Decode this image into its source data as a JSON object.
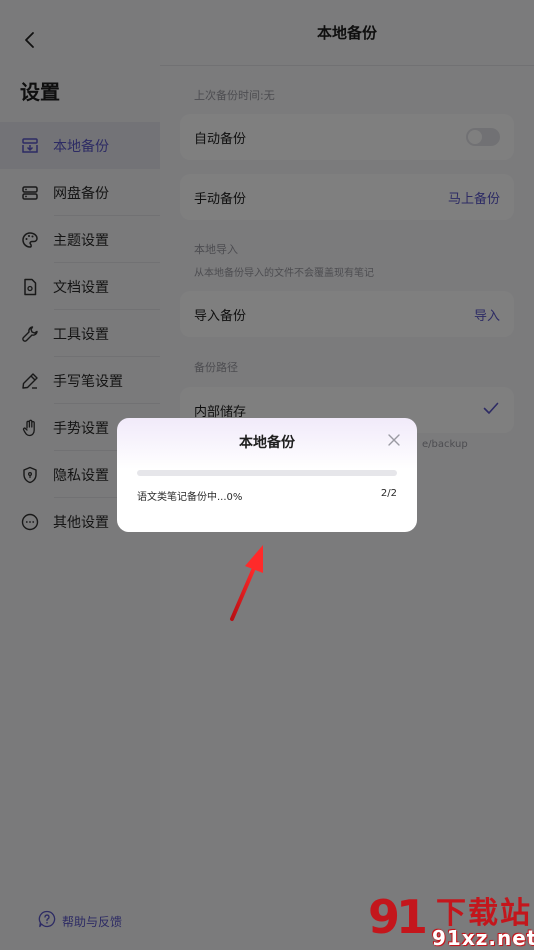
{
  "sidebar": {
    "title": "设置",
    "items": [
      {
        "label": "本地备份",
        "icon": "local-backup-icon",
        "active": true
      },
      {
        "label": "网盘备份",
        "icon": "cloud-drive-icon"
      },
      {
        "label": "主题设置",
        "icon": "palette-icon"
      },
      {
        "label": "文档设置",
        "icon": "document-icon"
      },
      {
        "label": "工具设置",
        "icon": "wrench-icon"
      },
      {
        "label": "手写笔设置",
        "icon": "pen-icon"
      },
      {
        "label": "手势设置",
        "icon": "hand-icon"
      },
      {
        "label": "隐私设置",
        "icon": "shield-icon"
      },
      {
        "label": "其他设置",
        "icon": "more-icon"
      }
    ],
    "help_label": "帮助与反馈"
  },
  "main": {
    "title": "本地备份",
    "last_backup": "上次备份时间:无",
    "auto_backup": {
      "label": "自动备份",
      "enabled": false
    },
    "manual_backup": {
      "label": "手动备份",
      "action": "马上备份"
    },
    "import_section": "本地导入",
    "import_note": "从本地备份导入的文件不会覆盖现有笔记",
    "import_backup": {
      "label": "导入备份",
      "action": "导入"
    },
    "path_section": "备份路径",
    "internal_storage": {
      "label": "内部储存",
      "selected": true,
      "path_partial": "e/backup"
    }
  },
  "dialog": {
    "title": "本地备份",
    "status": "语文类笔记备份中...0%",
    "count": "2/2",
    "progress": 0
  },
  "watermark": {
    "logo": "91",
    "top": "下载站",
    "bottom": "91xz.net"
  },
  "colors": {
    "accent": "#5a56c9",
    "arrow": "#e0141a",
    "watermark": "#c4161c"
  }
}
